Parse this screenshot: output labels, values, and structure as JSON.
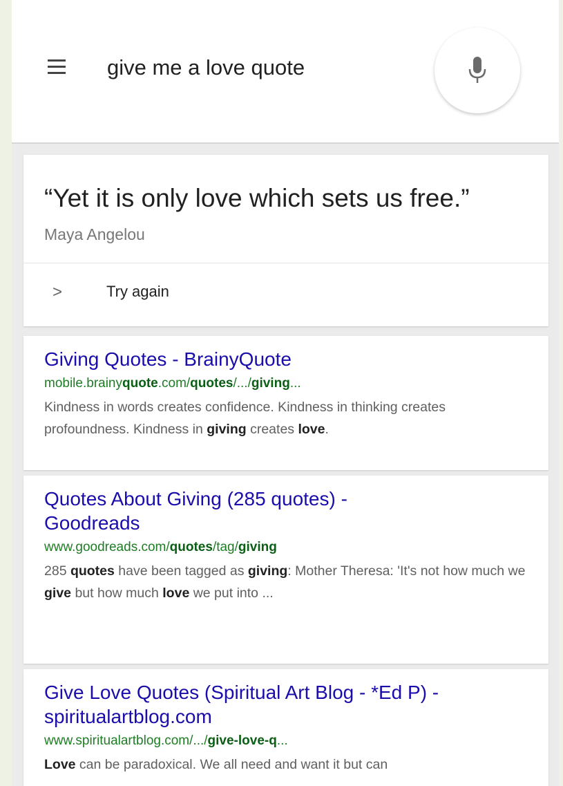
{
  "search": {
    "query": "give me a love quote"
  },
  "answer": {
    "quote": "“Yet it is only love which sets us free.”",
    "author": "Maya Angelou",
    "try_again": "Try again"
  },
  "results": [
    {
      "title": "Giving Quotes - BrainyQuote",
      "url": {
        "p0": "mobile.brainy",
        "p1": "quote",
        "p2": ".com/",
        "p3": "quotes",
        "p4": "/.../",
        "p5": "giving",
        "p6": "..."
      },
      "snippet": {
        "s0": "Kindness in words creates confidence. Kindness in thinking creates profoundness. Kindness in ",
        "s1": "giving",
        "s2": " creates ",
        "s3": "love",
        "s4": "."
      }
    },
    {
      "title_line1": "Quotes About Giving (285 quotes) -",
      "title_line2": "Goodreads",
      "url": {
        "p0": "www.goodreads.com/",
        "p1": "quotes",
        "p2": "/tag/",
        "p3": "giving"
      },
      "snippet": {
        "s0": "285 ",
        "s1": "quotes",
        "s2": " have been tagged as ",
        "s3": "giving",
        "s4": ": Mother Theresa: 'It's not how much we ",
        "s5": "give",
        "s6": " but how much ",
        "s7": "love",
        "s8": " we put into ..."
      }
    },
    {
      "title_line1": "Give Love Quotes (Spiritual Art Blog - *Ed P) -",
      "title_line2": "spiritualartblog.com",
      "url": {
        "p0": "www.spiritualartblog.com/.../",
        "p1": "give-love-q",
        "p2": "..."
      },
      "snippet": {
        "s0": "Love",
        "s1": " can be paradoxical. We all need and want it but can"
      }
    }
  ]
}
